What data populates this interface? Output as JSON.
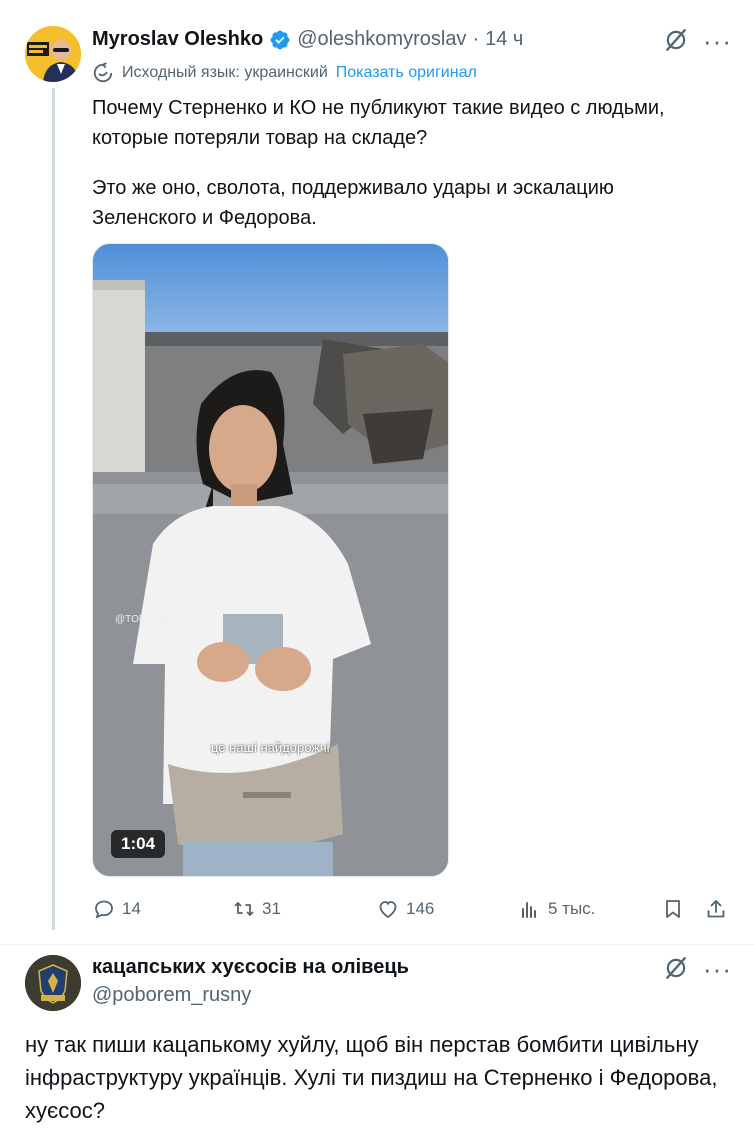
{
  "tweet": {
    "author_name": "Myroslav Oleshko",
    "handle": "@oleshkomyroslav",
    "separator": "·",
    "time": "14 ч",
    "translation_notice": "Исходный язык: украинский",
    "translation_link": "Показать оригинал",
    "text_p1": "Почему Стерненко и КО не публикуют такие видео с людьми, которые потеряли товар на складе?",
    "text_p2": "Это же оно, сволота, поддерживало удары и эскалацию Зеленского и Федорова.",
    "video": {
      "duration": "1:04",
      "caption": "це наші найдорожчі",
      "watermark": "@TODLIJA"
    },
    "stats": {
      "replies": "14",
      "reposts": "31",
      "likes": "146",
      "views": "5 тыс."
    }
  },
  "reply": {
    "author_name": "кацапських хуєсосів на олівець",
    "handle": "@poborem_rusny",
    "text": "ну так пиши кацапькому хуйлу, щоб він перстав бомбити цивільну інфраструктуру українців. Хулі ти пиздиш на Стерненко і Федорова, хуєсос?"
  },
  "colors": {
    "link": "#1d9bf0",
    "secondary_text": "#536471",
    "primary_text": "#0f1419",
    "verified": "#1d9bf0"
  }
}
